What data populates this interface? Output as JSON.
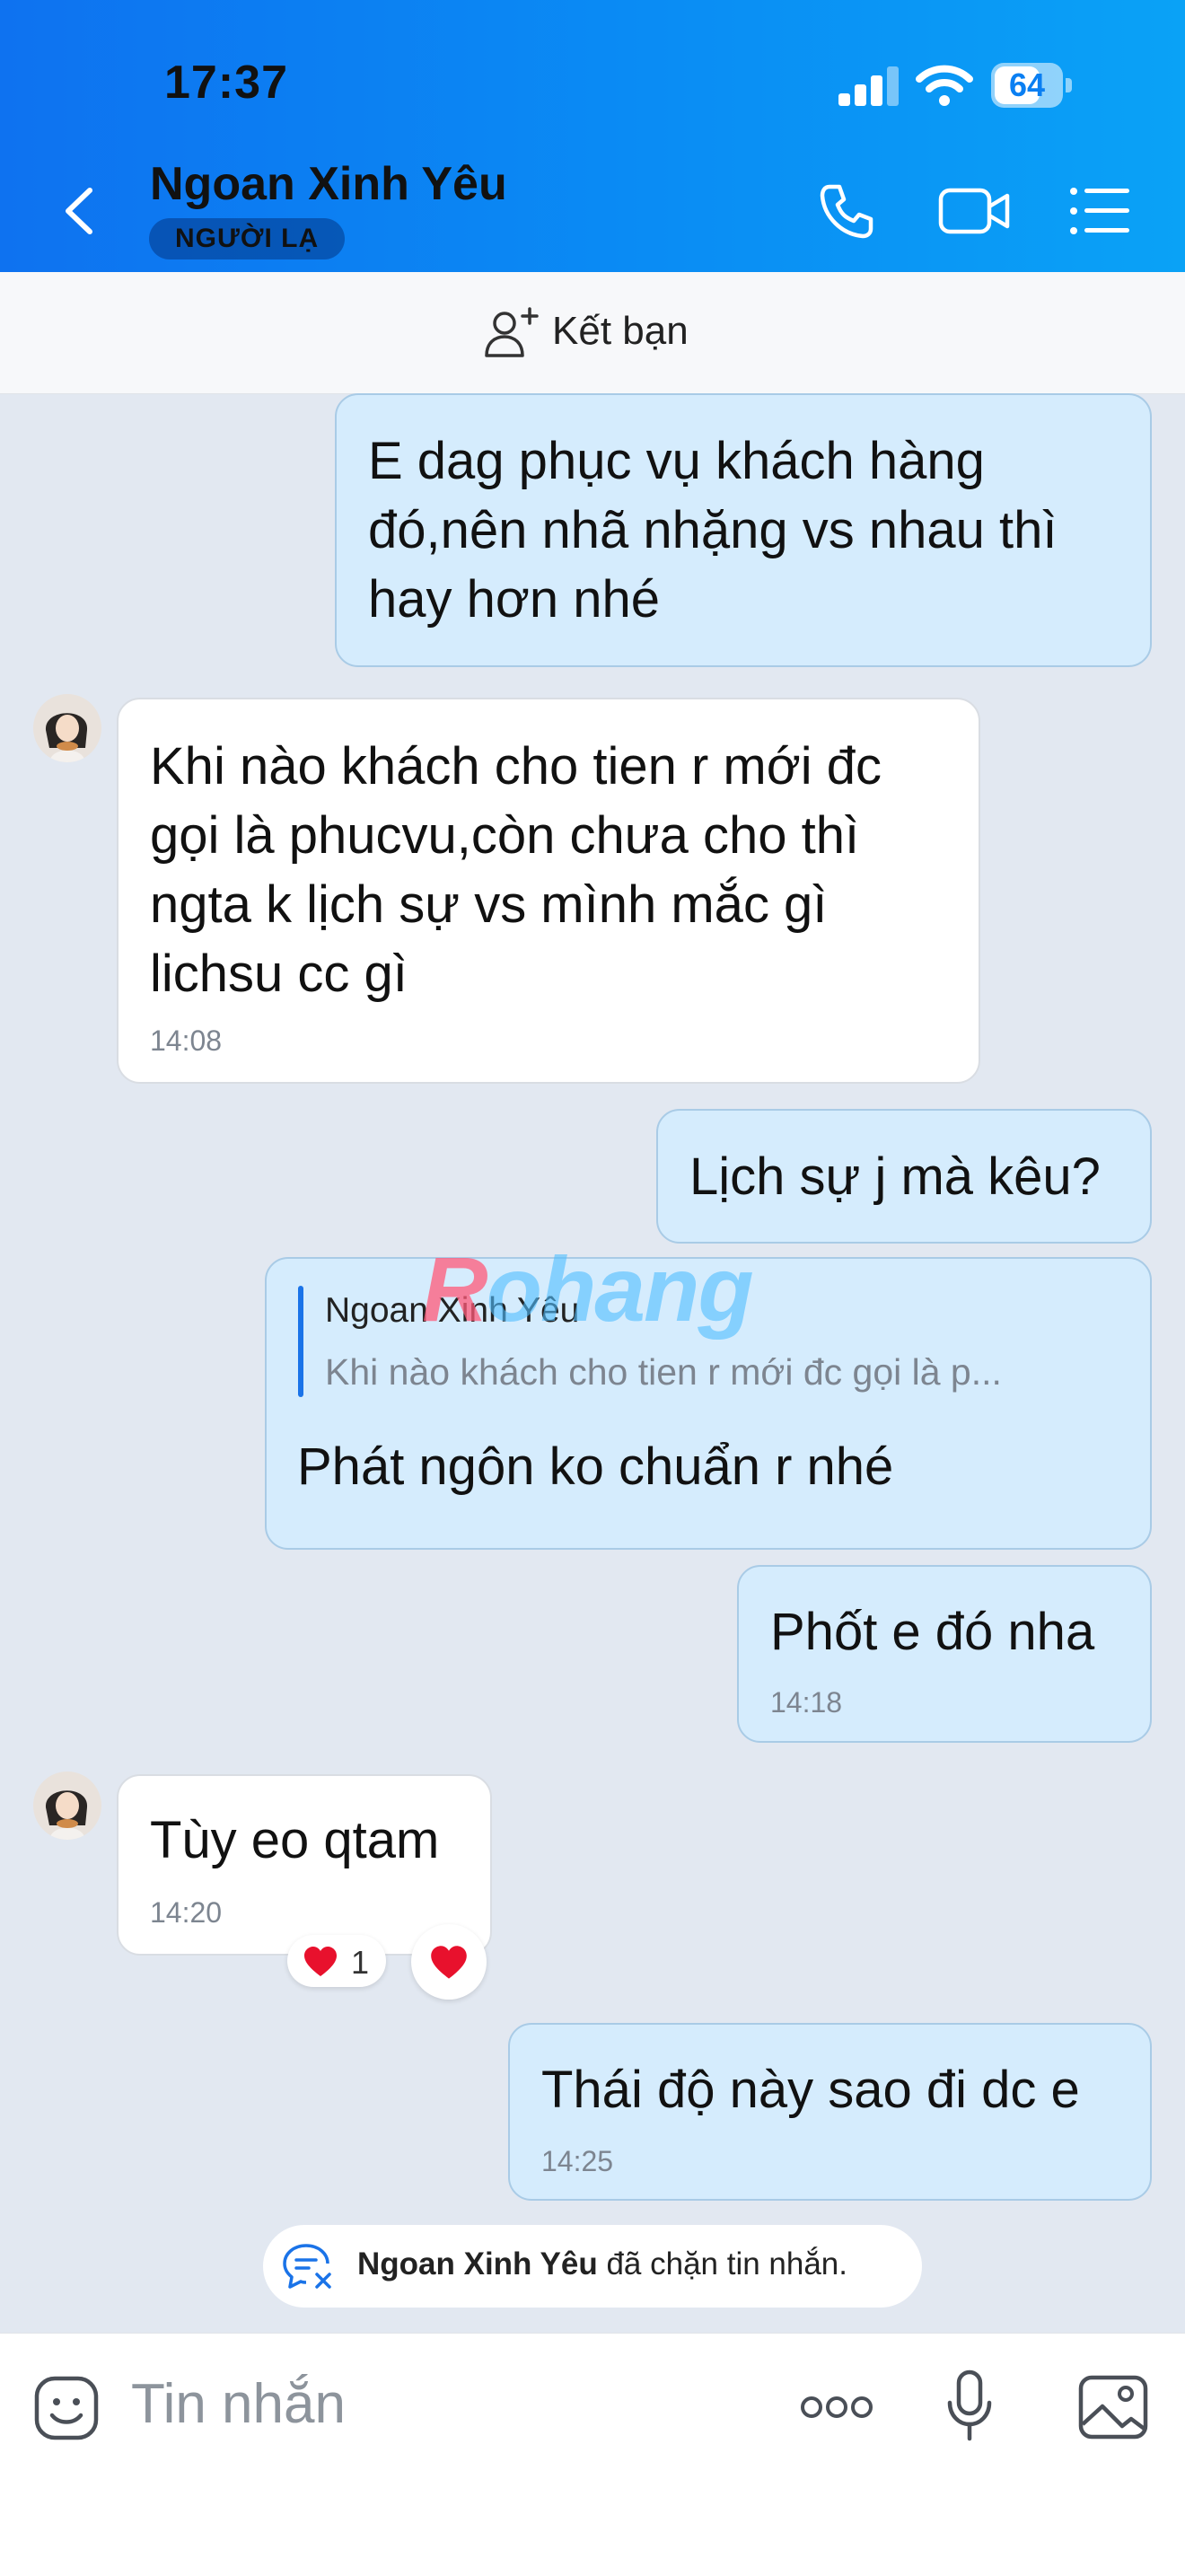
{
  "status_bar": {
    "time": "17:37",
    "battery": "64",
    "battery_level": 0.64
  },
  "header": {
    "contact_name": "Ngoan Xinh Yêu",
    "badge": "NGƯỜI LẠ",
    "icons": [
      "back-chevron-icon",
      "phone-icon",
      "video-camera-icon",
      "menu-list-icon"
    ]
  },
  "add_friend": {
    "label": "Kết bạn",
    "icon": "add-person-icon"
  },
  "messages": [
    {
      "side": "out",
      "lines": [
        "E dag phục vụ khách hàng",
        "đó,nên nhã nhặng vs nhau thì",
        "hay hơn nhé"
      ]
    },
    {
      "side": "in",
      "lines": [
        "Khi nào khách cho tien r mới đc",
        "gọi là phucvu,còn chưa cho thì",
        "ngta k lịch sự vs mình mắc gì",
        "lichsu cc gì"
      ],
      "time": "14:08"
    },
    {
      "side": "out",
      "lines": [
        "Lịch sự j mà kêu?"
      ]
    },
    {
      "side": "out",
      "quote_author": "Ngoan Xinh Yêu",
      "quote_text": "Khi nào khách cho tien r mới đc gọi là p...",
      "lines": [
        "Phát ngôn ko chuẩn r nhé"
      ]
    },
    {
      "side": "out",
      "lines": [
        "Phốt e đó nha"
      ],
      "time": "14:18"
    },
    {
      "side": "in",
      "lines": [
        "Tùy eo qtam"
      ],
      "time": "14:20",
      "reaction_count": "1"
    },
    {
      "side": "out",
      "lines": [
        "Thái độ này sao đi dc e"
      ],
      "time": "14:25"
    }
  ],
  "watermark": {
    "first": "R",
    "rest": "ohang"
  },
  "block_notice": {
    "name": "Ngoan Xinh Yêu",
    "text": " đã chặn tin nhắn."
  },
  "composer": {
    "placeholder": "Tin nhắn",
    "icons": [
      "sticker-icon",
      "more-dots-icon",
      "microphone-icon",
      "image-icon"
    ]
  },
  "colors": {
    "header_blue": "#0a8cf4",
    "outgoing_bubble": "#d5ecfd",
    "incoming_bubble": "#ffffff",
    "chat_background": "#e2e8f1",
    "heart": "#e8112d"
  }
}
